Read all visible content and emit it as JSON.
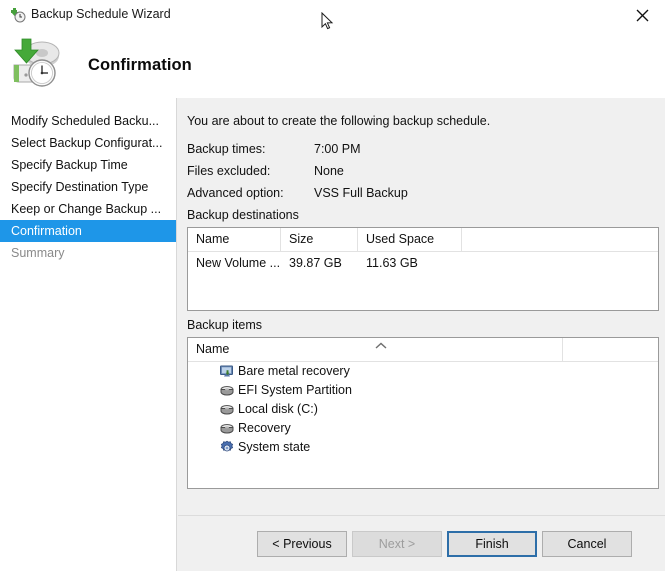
{
  "window": {
    "title": "Backup Schedule Wizard",
    "title_icon": "backup-schedule-icon",
    "close_icon": "close-icon"
  },
  "header": {
    "title": "Confirmation",
    "icon": "backup-disk-clock-icon"
  },
  "sidebar": {
    "items": [
      {
        "label": "Modify Scheduled Backu...",
        "state": "normal"
      },
      {
        "label": "Select Backup Configurat...",
        "state": "normal"
      },
      {
        "label": "Specify Backup Time",
        "state": "normal"
      },
      {
        "label": "Specify Destination Type",
        "state": "normal"
      },
      {
        "label": "Keep or Change Backup ...",
        "state": "normal"
      },
      {
        "label": "Confirmation",
        "state": "selected"
      },
      {
        "label": "Summary",
        "state": "disabled"
      }
    ],
    "selected_color": "#1e96e8"
  },
  "content": {
    "intro": "You are about to create the following backup schedule.",
    "summary": [
      {
        "label": "Backup times:",
        "value": "7:00 PM"
      },
      {
        "label": "Files excluded:",
        "value": "None"
      },
      {
        "label": "Advanced option:",
        "value": "VSS Full Backup"
      }
    ],
    "destinations": {
      "group_label": "Backup destinations",
      "columns": [
        "Name",
        "Size",
        "Used Space"
      ],
      "rows": [
        {
          "name": "New Volume ...",
          "size": "39.87 GB",
          "used": "11.63 GB"
        }
      ]
    },
    "items": {
      "group_label": "Backup items",
      "column": "Name",
      "sort_icon": "sort-ascending-chevron-icon",
      "rows": [
        {
          "label": "Bare metal recovery",
          "icon": "bare-metal-recovery-icon"
        },
        {
          "label": "EFI System Partition",
          "icon": "drive-icon"
        },
        {
          "label": "Local disk (C:)",
          "icon": "drive-icon"
        },
        {
          "label": "Recovery",
          "icon": "drive-icon"
        },
        {
          "label": "System state",
          "icon": "system-state-gear-icon"
        }
      ]
    }
  },
  "buttons": {
    "previous": "< Previous",
    "next": "Next >",
    "finish": "Finish",
    "cancel": "Cancel",
    "default_button_border": "#2d6ea8"
  },
  "cursor": {
    "icon": "mouse-pointer-arrow-icon"
  }
}
